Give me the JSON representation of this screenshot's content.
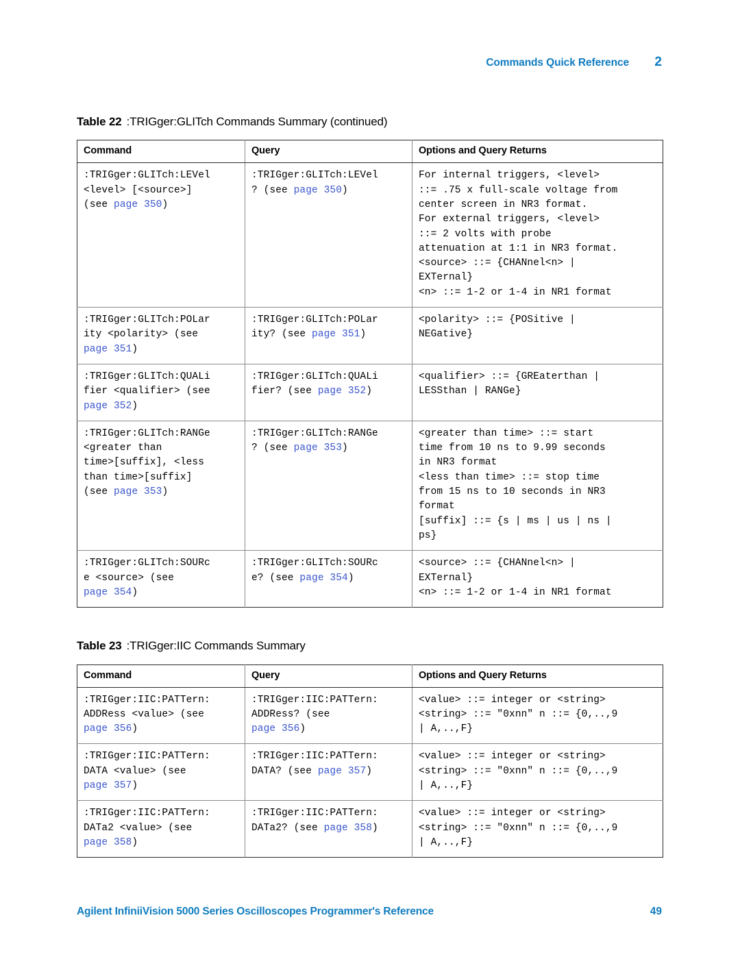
{
  "header": {
    "title": "Commands Quick Reference",
    "chapter": "2"
  },
  "footer": {
    "title": "Agilent InfiniiVision 5000 Series Oscilloscopes Programmer's Reference",
    "page_number": "49"
  },
  "columns": {
    "command": "Command",
    "query": "Query",
    "options": "Options and Query Returns"
  },
  "tables": [
    {
      "caption_lead": "Table 22",
      "caption_text": ":TRIGger:GLITch Commands Summary (continued)",
      "rows": [
        {
          "command": ":TRIGger:GLITch:LEVel <level> [<source>] (see page 350)",
          "query": ":TRIGger:GLITch:LEVel ? (see page 350)",
          "options": "For internal triggers, <level> ::= .75 x full-scale voltage from center screen in NR3 format. For external triggers, <level> ::= 2 volts with probe attenuation at 1:1 in NR3 format. <source> ::= {CHANnel<n> | EXTernal} <n> ::= 1-2 or 1-4 in NR1 format"
        },
        {
          "command": ":TRIGger:GLITch:POLarity <polarity> (see page 351)",
          "query": ":TRIGger:GLITch:POLarity? (see page 351)",
          "options": "<polarity> ::= {POSitive | NEGative}"
        },
        {
          "command": ":TRIGger:GLITch:QUALifier <qualifier> (see page 352)",
          "query": ":TRIGger:GLITch:QUALifier? (see page 352)",
          "options": "<qualifier> ::= {GREaterthan | LESSthan | RANGe}"
        },
        {
          "command": ":TRIGger:GLITch:RANGe <greater than time>[suffix], <less than time>[suffix] (see page 353)",
          "query": ":TRIGger:GLITch:RANGe ? (see page 353)",
          "options": "<greater than time> ::= start time from 10 ns to 9.99 seconds in NR3 format <less than time> ::= stop time from 15 ns to 10 seconds in NR3 format [suffix] ::= {s | ms | us | ns | ps}"
        },
        {
          "command": ":TRIGger:GLITch:SOURce <source> (see page 354)",
          "query": ":TRIGger:GLITch:SOURce? (see page 354)",
          "options": "<source> ::= {CHANnel<n> | EXTernal} <n> ::= 1-2 or 1-4 in NR1 format"
        }
      ]
    },
    {
      "caption_lead": "Table 23",
      "caption_text": ":TRIGger:IIC Commands Summary",
      "rows": [
        {
          "command": ":TRIGger:IIC:PATTern:ADDRess <value> (see page 356)",
          "query": ":TRIGger:IIC:PATTern:ADDRess? (see page 356)",
          "options": "<value> ::= integer or <string> <string> ::= \"0xnn\" n ::= {0,..,9 | A,..,F}"
        },
        {
          "command": ":TRIGger:IIC:PATTern:DATA <value> (see page 357)",
          "query": ":TRIGger:IIC:PATTern:DATA? (see page 357)",
          "options": "<value> ::= integer or <string> <string> ::= \"0xnn\" n ::= {0,..,9 | A,..,F}"
        },
        {
          "command": ":TRIGger:IIC:PATTern:DATa2 <value> (see page 358)",
          "query": ":TRIGger:IIC:PATTern:DATa2? (see page 358)",
          "options": "<value> ::= integer or <string> <string> ::= \"0xnn\" n ::= {0,..,9 | A,..,F}"
        }
      ]
    }
  ],
  "cell_lines": {
    "t0": [
      {
        "command": [
          ":TRIGger:GLITch:LEVel",
          "<level> [<source>]",
          "(see §page 350§)"
        ],
        "query": [
          ":TRIGger:GLITch:LEVel",
          "? (see §page 350§)"
        ],
        "options": [
          "For internal triggers, <level>",
          "::= .75 x full-scale voltage from",
          "center screen in NR3 format.",
          "For external triggers, <level>",
          "::= 2 volts with probe",
          "attenuation at 1:1 in NR3 format.",
          "<source> ::= {CHANnel<n> |",
          "EXTernal}",
          "<n> ::= 1-2 or 1-4 in NR1 format"
        ]
      },
      {
        "command": [
          ":TRIGger:GLITch:POLar",
          "ity <polarity> (see",
          "§page 351§)"
        ],
        "query": [
          ":TRIGger:GLITch:POLar",
          "ity? (see §page 351§)"
        ],
        "options": [
          "<polarity> ::= {POSitive |",
          "NEGative}"
        ]
      },
      {
        "command": [
          ":TRIGger:GLITch:QUALi",
          "fier <qualifier> (see",
          "§page 352§)"
        ],
        "query": [
          ":TRIGger:GLITch:QUALi",
          "fier? (see §page 352§)"
        ],
        "options": [
          "<qualifier> ::= {GREaterthan |",
          "LESSthan | RANGe}"
        ]
      },
      {
        "command": [
          ":TRIGger:GLITch:RANGe",
          "<greater than",
          "time>[suffix], <less",
          "than time>[suffix]",
          "(see §page 353§)"
        ],
        "query": [
          ":TRIGger:GLITch:RANGe",
          "? (see §page 353§)"
        ],
        "options": [
          "<greater than time> ::= start",
          "time from 10 ns to 9.99 seconds",
          "in NR3 format",
          "<less than time> ::= stop time",
          "from 15 ns to 10 seconds in NR3",
          "format",
          "[suffix] ::= {s | ms | us | ns |",
          "ps}"
        ]
      },
      {
        "command": [
          ":TRIGger:GLITch:SOURc",
          "e <source> (see",
          "§page 354§)"
        ],
        "query": [
          ":TRIGger:GLITch:SOURc",
          "e? (see §page 354§)"
        ],
        "options": [
          "<source> ::= {CHANnel<n> |",
          "EXTernal}",
          "<n> ::= 1-2 or 1-4 in NR1 format"
        ]
      }
    ],
    "t1": [
      {
        "command": [
          ":TRIGger:IIC:PATTern:",
          "ADDRess <value> (see",
          "§page 356§)"
        ],
        "query": [
          ":TRIGger:IIC:PATTern:",
          "ADDRess? (see",
          "§page 356§)"
        ],
        "options": [
          "<value> ::= integer or <string>",
          "<string> ::= \"0xnn\" n ::= {0,..,9",
          "| A,..,F}"
        ]
      },
      {
        "command": [
          ":TRIGger:IIC:PATTern:",
          "DATA <value> (see",
          "§page 357§)"
        ],
        "query": [
          ":TRIGger:IIC:PATTern:",
          "DATA? (see §page 357§)"
        ],
        "options": [
          "<value> ::= integer or <string>",
          "<string> ::= \"0xnn\" n ::= {0,..,9",
          "| A,..,F}"
        ]
      },
      {
        "command": [
          ":TRIGger:IIC:PATTern:",
          "DATa2 <value> (see",
          "§page 358§)"
        ],
        "query": [
          ":TRIGger:IIC:PATTern:",
          "DATa2? (see §page 358§)"
        ],
        "options": [
          "<value> ::= integer or <string>",
          "<string> ::= \"0xnn\" n ::= {0,..,9",
          "| A,..,F}"
        ]
      }
    ]
  },
  "colors": {
    "brand_blue": "#0f7cc0",
    "link_blue": "#3a55cc",
    "rule_dark": "#2a2a2a",
    "rule_light": "#8a8a8a"
  }
}
